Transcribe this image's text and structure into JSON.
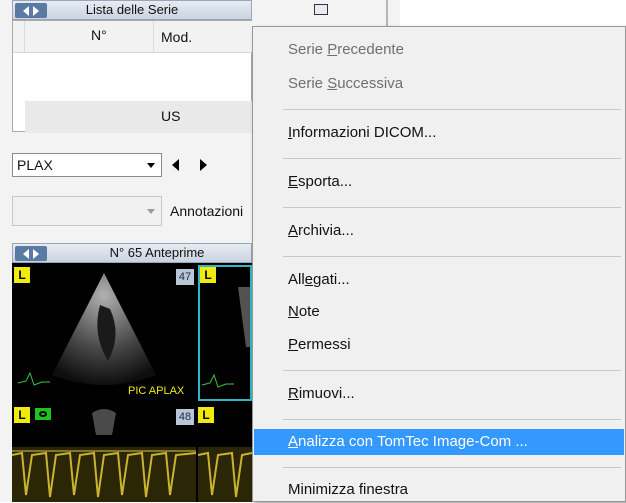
{
  "series_panel": {
    "title": "Lista delle Serie",
    "columns": [
      "N°",
      "Mod."
    ],
    "rows": [
      {
        "number": "",
        "modality": "US"
      }
    ]
  },
  "view_selector": {
    "selected": "PLAX"
  },
  "annotation": {
    "value": "",
    "label": "Annotazioni"
  },
  "preview_panel": {
    "title": "N° 65 Anteprime",
    "thumbnails": [
      {
        "number": "47",
        "badge": "L",
        "caption": "PIC APLAX"
      },
      {
        "number": "",
        "badge": "L",
        "caption": ""
      },
      {
        "number": "48",
        "badge": "L",
        "caption": ""
      },
      {
        "number": "",
        "badge": "L",
        "caption": ""
      }
    ]
  },
  "context_menu": {
    "items": [
      {
        "pre": "Serie ",
        "key": "P",
        "post": "recedente",
        "disabled": true
      },
      {
        "pre": "Serie ",
        "key": "S",
        "post": "uccessiva",
        "disabled": true
      },
      {
        "pre": "",
        "key": "I",
        "post": "nformazioni DICOM...",
        "disabled": false
      },
      {
        "pre": "",
        "key": "E",
        "post": "sporta...",
        "disabled": false
      },
      {
        "pre": "",
        "key": "A",
        "post": "rchivia...",
        "disabled": false
      },
      {
        "pre": "All",
        "key": "e",
        "post": "gati...",
        "disabled": false
      },
      {
        "pre": "",
        "key": "N",
        "post": "ote",
        "disabled": false
      },
      {
        "pre": "",
        "key": "P",
        "post": "ermessi",
        "disabled": false
      },
      {
        "pre": "",
        "key": "R",
        "post": "imuovi...",
        "disabled": false
      },
      {
        "pre": "",
        "key": "A",
        "post": "nalizza con TomTec Image-Com ...",
        "disabled": false,
        "highlighted": true
      },
      {
        "pre": "Minimizza finestra",
        "key": "",
        "post": "",
        "disabled": false
      }
    ]
  },
  "colors": {
    "highlight": "#3399ff",
    "header_button": "#5b7aa3",
    "thumbnail_selected": "#2bb8c8",
    "label_yellow": "#f1ea0e"
  }
}
